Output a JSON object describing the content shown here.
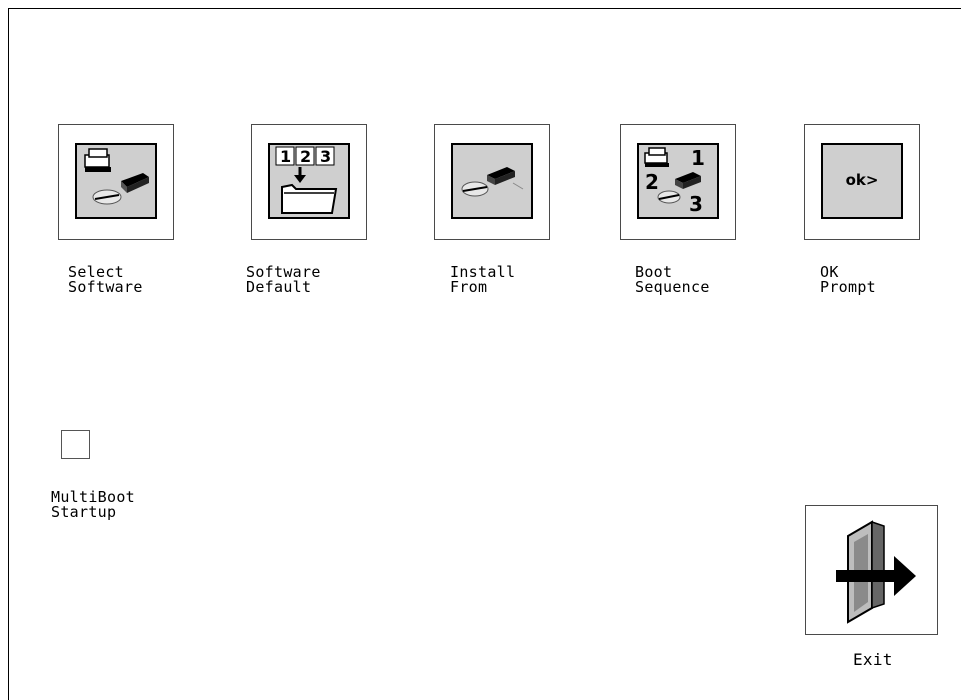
{
  "menu": {
    "items": [
      {
        "line1": "Select",
        "line2": "Software",
        "icon": "select-software-icon"
      },
      {
        "line1": "Software",
        "line2": "Default",
        "icon": "software-default-icon"
      },
      {
        "line1": "Install",
        "line2": "From",
        "icon": "install-from-icon"
      },
      {
        "line1": "Boot",
        "line2": "Sequence",
        "icon": "boot-sequence-icon"
      },
      {
        "line1": "OK",
        "line2": "Prompt",
        "icon": "ok-prompt-icon",
        "icon_text": "ok>"
      }
    ],
    "multiboot": {
      "line1": "MultiBoot",
      "line2": "Startup"
    },
    "exit": {
      "label": "Exit",
      "icon": "exit-door-icon"
    }
  },
  "colors": {
    "icon_fill": "#cfcfcf",
    "border": "#000000"
  }
}
